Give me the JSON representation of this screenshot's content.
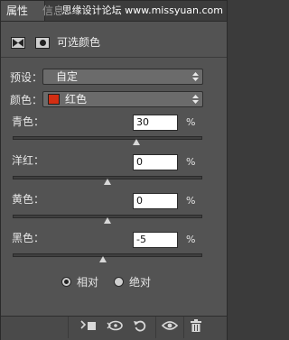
{
  "tabs": [
    {
      "label": "属性",
      "active": true
    },
    {
      "label": "信息",
      "active": false
    }
  ],
  "watermark": "思缘设计论坛 www.missyuan.com",
  "header": {
    "title": "可选颜色"
  },
  "preset": {
    "label": "预设：",
    "value": "自定"
  },
  "colors": {
    "label": "颜色：",
    "value": "红色",
    "swatch": "#d32e12"
  },
  "sliders": [
    {
      "label": "青色：",
      "value": "30",
      "unit": "%",
      "level": 30
    },
    {
      "label": "洋红：",
      "value": "0",
      "unit": "%",
      "level": 0
    },
    {
      "label": "黄色：",
      "value": "0",
      "unit": "%",
      "level": 0
    },
    {
      "label": "黑色：",
      "value": "-5",
      "unit": "%",
      "level": -5
    }
  ],
  "method": {
    "relative": "相对",
    "absolute": "绝对",
    "selected": "relative"
  },
  "bottom_icons": [
    "clip-to-layer-icon",
    "view-previous-icon",
    "reset-icon",
    "visibility-icon",
    "trash-icon"
  ]
}
